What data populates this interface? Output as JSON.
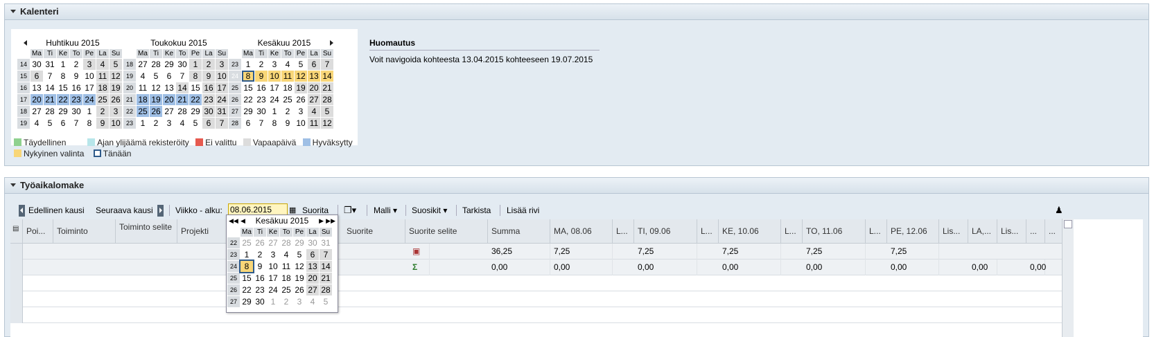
{
  "calendar_panel": {
    "title": "Kalenteri"
  },
  "months": [
    {
      "title": "Huhtikuu 2015",
      "headers": [
        "Ma",
        "Ti",
        "Ke",
        "To",
        "Pe",
        "La",
        "Su"
      ],
      "weeks": [
        [
          "14",
          "30",
          "31",
          "1",
          "2",
          "3",
          "4",
          "5"
        ],
        [
          "15",
          "6",
          "7",
          "8",
          "9",
          "10",
          "11",
          "12"
        ],
        [
          "16",
          "13",
          "14",
          "15",
          "16",
          "17",
          "18",
          "19"
        ],
        [
          "17",
          "20",
          "21",
          "22",
          "23",
          "24",
          "25",
          "26"
        ],
        [
          "18",
          "27",
          "28",
          "29",
          "30",
          "1",
          "2",
          "3"
        ],
        [
          "19",
          "4",
          "5",
          "6",
          "7",
          "8",
          "9",
          "10"
        ]
      ]
    },
    {
      "title": "Toukokuu 2015",
      "headers": [
        "Ma",
        "Ti",
        "Ke",
        "To",
        "Pe",
        "La",
        "Su"
      ],
      "weeks": [
        [
          "18",
          "27",
          "28",
          "29",
          "30",
          "1",
          "2",
          "3"
        ],
        [
          "19",
          "4",
          "5",
          "6",
          "7",
          "8",
          "9",
          "10"
        ],
        [
          "20",
          "11",
          "12",
          "13",
          "14",
          "15",
          "16",
          "17"
        ],
        [
          "21",
          "18",
          "19",
          "20",
          "21",
          "22",
          "23",
          "24"
        ],
        [
          "22",
          "25",
          "26",
          "27",
          "28",
          "29",
          "30",
          "31"
        ],
        [
          "23",
          "1",
          "2",
          "3",
          "4",
          "5",
          "6",
          "7"
        ]
      ]
    },
    {
      "title": "Kesäkuu 2015",
      "headers": [
        "Ma",
        "Ti",
        "Ke",
        "To",
        "Pe",
        "La",
        "Su"
      ],
      "weeks": [
        [
          "23",
          "1",
          "2",
          "3",
          "4",
          "5",
          "6",
          "7"
        ],
        [
          "24",
          "8",
          "9",
          "10",
          "11",
          "12",
          "13",
          "14"
        ],
        [
          "25",
          "15",
          "16",
          "17",
          "18",
          "19",
          "20",
          "21"
        ],
        [
          "26",
          "22",
          "23",
          "24",
          "25",
          "26",
          "27",
          "28"
        ],
        [
          "27",
          "29",
          "30",
          "1",
          "2",
          "3",
          "4",
          "5"
        ],
        [
          "28",
          "6",
          "7",
          "8",
          "9",
          "10",
          "11",
          "12"
        ]
      ]
    }
  ],
  "legend": {
    "complete": "Täydellinen",
    "overtime": "Ajan ylijäämä rekisteröity",
    "not_sent": "Ei valittu",
    "free_day": "Vapaapäivä",
    "approved": "Hyväksytty",
    "current": "Nykyinen valinta",
    "today": "Tänään"
  },
  "colors": {
    "complete": "#8fd18f",
    "overtime": "#b8e6ea",
    "not_sent": "#e65a4f",
    "free_day": "#dcdcdc",
    "approved": "#9fbfe5",
    "current": "#f8d678",
    "today": "#2e5a8a"
  },
  "note": {
    "title": "Huomautus",
    "text": "Voit navigoida kohteesta 13.04.2015 kohteeseen 19.07.2015"
  },
  "timesheet_panel": {
    "title": "Työaikalomake"
  },
  "toolbar": {
    "prev": "Edellinen kausi",
    "next": "Seuraava kausi",
    "week_label": "Viikko - alku:",
    "week_value": "08.06.2015",
    "execute": "Suorita",
    "template": "Malli",
    "favorites": "Suosikit",
    "check": "Tarkista",
    "add_row": "Lisää rivi"
  },
  "columns": {
    "c1": "Poi...",
    "c2": "Toiminto",
    "c3": "Toiminto selite",
    "c4": "Projekti",
    "c5": "Suorite",
    "c6": "Suorite selite",
    "c7": "Summa",
    "c8": "MA, 08.06",
    "c9": "L...",
    "c10": "TI, 09.06",
    "c11": "L...",
    "c12": "KE, 10.06",
    "c13": "L...",
    "c14": "TO, 11.06",
    "c15": "L...",
    "c16": "PE, 12.06",
    "c17": "Lis...",
    "c18": "LA,...",
    "c19": "Lis...",
    "c20": "...",
    "c21": "..."
  },
  "rows": [
    {
      "sum": "36,25",
      "ma": "7,25",
      "ti": "7,25",
      "ke": "7,25",
      "to": "7,25",
      "pe": "7,25",
      "la": "",
      "su": ""
    },
    {
      "sum": "0,00",
      "ma": "0,00",
      "ti": "0,00",
      "ke": "0,00",
      "to": "0,00",
      "pe": "0,00",
      "la": "0,00",
      "su": "0,00"
    }
  ],
  "popup": {
    "title": "Kesäkuu 2015",
    "headers": [
      "Ma",
      "Ti",
      "Ke",
      "To",
      "Pe",
      "La",
      "Su"
    ],
    "weeks": [
      [
        "22",
        "25",
        "26",
        "27",
        "28",
        "29",
        "30",
        "31"
      ],
      [
        "23",
        "1",
        "2",
        "3",
        "4",
        "5",
        "6",
        "7"
      ],
      [
        "24",
        "8",
        "9",
        "10",
        "11",
        "12",
        "13",
        "14"
      ],
      [
        "25",
        "15",
        "16",
        "17",
        "18",
        "19",
        "20",
        "21"
      ],
      [
        "26",
        "22",
        "23",
        "24",
        "25",
        "26",
        "27",
        "28"
      ],
      [
        "27",
        "29",
        "30",
        "1",
        "2",
        "3",
        "4",
        "5"
      ]
    ]
  }
}
